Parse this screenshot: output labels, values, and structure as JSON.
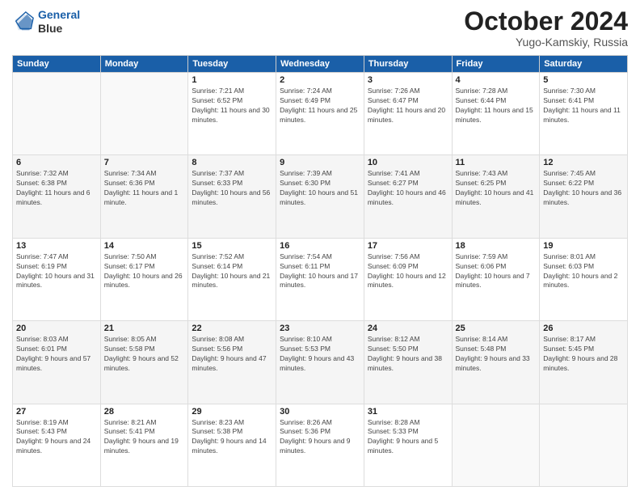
{
  "logo": {
    "line1": "General",
    "line2": "Blue"
  },
  "title": "October 2024",
  "subtitle": "Yugo-Kamskiy, Russia",
  "days_of_week": [
    "Sunday",
    "Monday",
    "Tuesday",
    "Wednesday",
    "Thursday",
    "Friday",
    "Saturday"
  ],
  "weeks": [
    [
      {
        "day": "",
        "info": ""
      },
      {
        "day": "",
        "info": ""
      },
      {
        "day": "1",
        "info": "Sunrise: 7:21 AM\nSunset: 6:52 PM\nDaylight: 11 hours and 30 minutes."
      },
      {
        "day": "2",
        "info": "Sunrise: 7:24 AM\nSunset: 6:49 PM\nDaylight: 11 hours and 25 minutes."
      },
      {
        "day": "3",
        "info": "Sunrise: 7:26 AM\nSunset: 6:47 PM\nDaylight: 11 hours and 20 minutes."
      },
      {
        "day": "4",
        "info": "Sunrise: 7:28 AM\nSunset: 6:44 PM\nDaylight: 11 hours and 15 minutes."
      },
      {
        "day": "5",
        "info": "Sunrise: 7:30 AM\nSunset: 6:41 PM\nDaylight: 11 hours and 11 minutes."
      }
    ],
    [
      {
        "day": "6",
        "info": "Sunrise: 7:32 AM\nSunset: 6:38 PM\nDaylight: 11 hours and 6 minutes."
      },
      {
        "day": "7",
        "info": "Sunrise: 7:34 AM\nSunset: 6:36 PM\nDaylight: 11 hours and 1 minute."
      },
      {
        "day": "8",
        "info": "Sunrise: 7:37 AM\nSunset: 6:33 PM\nDaylight: 10 hours and 56 minutes."
      },
      {
        "day": "9",
        "info": "Sunrise: 7:39 AM\nSunset: 6:30 PM\nDaylight: 10 hours and 51 minutes."
      },
      {
        "day": "10",
        "info": "Sunrise: 7:41 AM\nSunset: 6:27 PM\nDaylight: 10 hours and 46 minutes."
      },
      {
        "day": "11",
        "info": "Sunrise: 7:43 AM\nSunset: 6:25 PM\nDaylight: 10 hours and 41 minutes."
      },
      {
        "day": "12",
        "info": "Sunrise: 7:45 AM\nSunset: 6:22 PM\nDaylight: 10 hours and 36 minutes."
      }
    ],
    [
      {
        "day": "13",
        "info": "Sunrise: 7:47 AM\nSunset: 6:19 PM\nDaylight: 10 hours and 31 minutes."
      },
      {
        "day": "14",
        "info": "Sunrise: 7:50 AM\nSunset: 6:17 PM\nDaylight: 10 hours and 26 minutes."
      },
      {
        "day": "15",
        "info": "Sunrise: 7:52 AM\nSunset: 6:14 PM\nDaylight: 10 hours and 21 minutes."
      },
      {
        "day": "16",
        "info": "Sunrise: 7:54 AM\nSunset: 6:11 PM\nDaylight: 10 hours and 17 minutes."
      },
      {
        "day": "17",
        "info": "Sunrise: 7:56 AM\nSunset: 6:09 PM\nDaylight: 10 hours and 12 minutes."
      },
      {
        "day": "18",
        "info": "Sunrise: 7:59 AM\nSunset: 6:06 PM\nDaylight: 10 hours and 7 minutes."
      },
      {
        "day": "19",
        "info": "Sunrise: 8:01 AM\nSunset: 6:03 PM\nDaylight: 10 hours and 2 minutes."
      }
    ],
    [
      {
        "day": "20",
        "info": "Sunrise: 8:03 AM\nSunset: 6:01 PM\nDaylight: 9 hours and 57 minutes."
      },
      {
        "day": "21",
        "info": "Sunrise: 8:05 AM\nSunset: 5:58 PM\nDaylight: 9 hours and 52 minutes."
      },
      {
        "day": "22",
        "info": "Sunrise: 8:08 AM\nSunset: 5:56 PM\nDaylight: 9 hours and 47 minutes."
      },
      {
        "day": "23",
        "info": "Sunrise: 8:10 AM\nSunset: 5:53 PM\nDaylight: 9 hours and 43 minutes."
      },
      {
        "day": "24",
        "info": "Sunrise: 8:12 AM\nSunset: 5:50 PM\nDaylight: 9 hours and 38 minutes."
      },
      {
        "day": "25",
        "info": "Sunrise: 8:14 AM\nSunset: 5:48 PM\nDaylight: 9 hours and 33 minutes."
      },
      {
        "day": "26",
        "info": "Sunrise: 8:17 AM\nSunset: 5:45 PM\nDaylight: 9 hours and 28 minutes."
      }
    ],
    [
      {
        "day": "27",
        "info": "Sunrise: 8:19 AM\nSunset: 5:43 PM\nDaylight: 9 hours and 24 minutes."
      },
      {
        "day": "28",
        "info": "Sunrise: 8:21 AM\nSunset: 5:41 PM\nDaylight: 9 hours and 19 minutes."
      },
      {
        "day": "29",
        "info": "Sunrise: 8:23 AM\nSunset: 5:38 PM\nDaylight: 9 hours and 14 minutes."
      },
      {
        "day": "30",
        "info": "Sunrise: 8:26 AM\nSunset: 5:36 PM\nDaylight: 9 hours and 9 minutes."
      },
      {
        "day": "31",
        "info": "Sunrise: 8:28 AM\nSunset: 5:33 PM\nDaylight: 9 hours and 5 minutes."
      },
      {
        "day": "",
        "info": ""
      },
      {
        "day": "",
        "info": ""
      }
    ]
  ]
}
